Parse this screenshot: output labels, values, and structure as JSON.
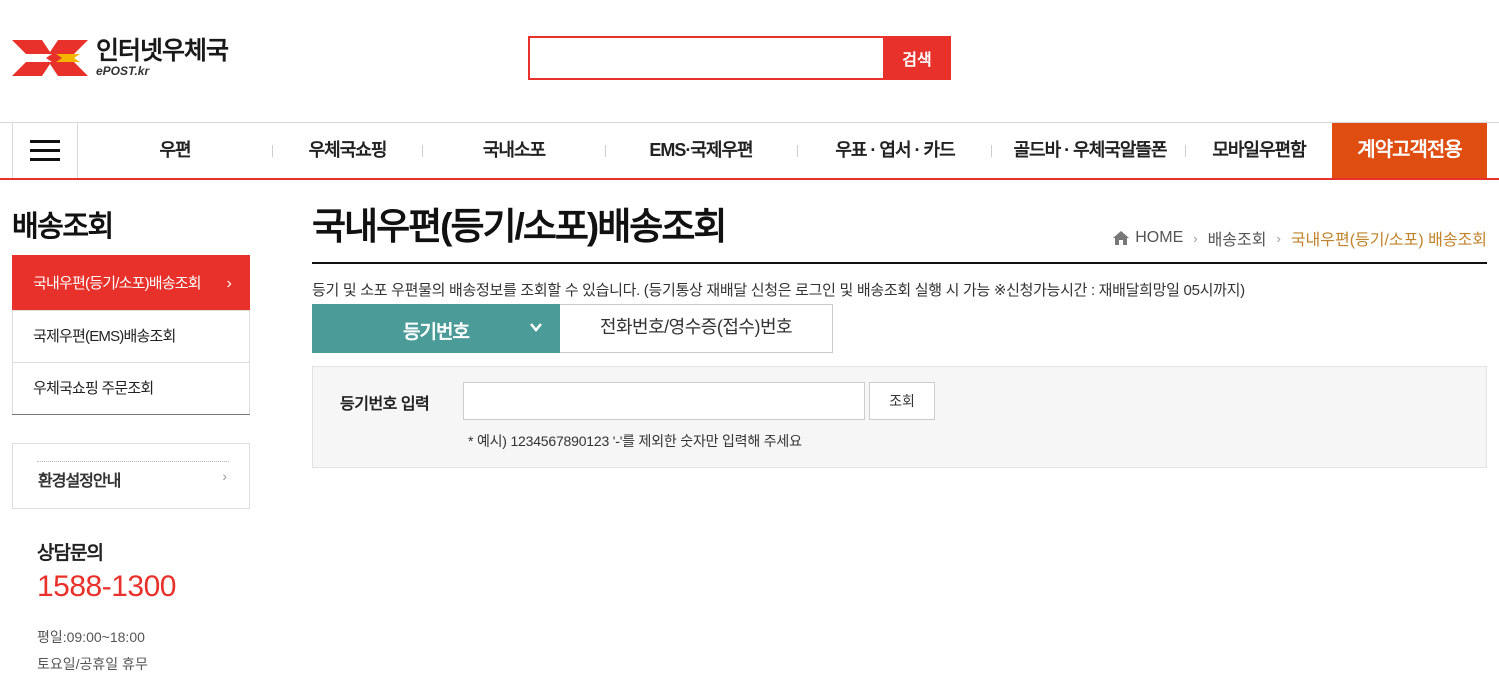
{
  "header": {
    "logo_title": "인터넷우체국",
    "logo_sub": "ePOST.kr",
    "search": {
      "value": "",
      "placeholder": "",
      "button": "검색"
    }
  },
  "gnb": {
    "items": [
      "우편",
      "우체국쇼핑",
      "국내소포",
      "EMS·국제우편",
      "우표 · 엽서 · 카드",
      "골드바 · 우체국알뜰폰",
      "모바일우편함"
    ],
    "contract": "계약고객전용"
  },
  "sidebar": {
    "title": "배송조회",
    "items": [
      {
        "label": "국내우편(등기/소포)배송조회"
      },
      {
        "label": "국제우편(EMS)배송조회"
      },
      {
        "label": "우체국쇼핑 주문조회"
      }
    ],
    "env_label": "환경설정안내",
    "cs": {
      "title": "상담문의",
      "phone": "1588-1300",
      "hours_weekday": "평일:09:00~18:00",
      "hours_weekend": "토요일/공휴일 휴무"
    }
  },
  "main": {
    "title": "국내우편(등기/소포)배송조회",
    "breadcrumb": {
      "home": "HOME",
      "level1": "배송조회",
      "current": "국내우편(등기/소포) 배송조회"
    },
    "description": "등기 및 소포 우편물의 배송정보를 조회할 수 있습니다. (등기통상 재배달 신청은 로그인 및 배송조회 실행 시 가능 ※신청가능시간 : 재배달희망일 05시까지)",
    "tabs": {
      "active": "등기번호",
      "other": "전화번호/영수증(접수)번호"
    },
    "query": {
      "label": "등기번호 입력",
      "value": "",
      "placeholder": "",
      "button": "조회",
      "hint": "* 예시) 1234567890123 '-'를 제외한 숫자만 입력해 주세요"
    }
  },
  "colors": {
    "brand_red": "#e8312a",
    "contract_orange": "#e04d10",
    "tab_teal": "#4b9b99",
    "breadcrumb_current": "#c0832a"
  }
}
